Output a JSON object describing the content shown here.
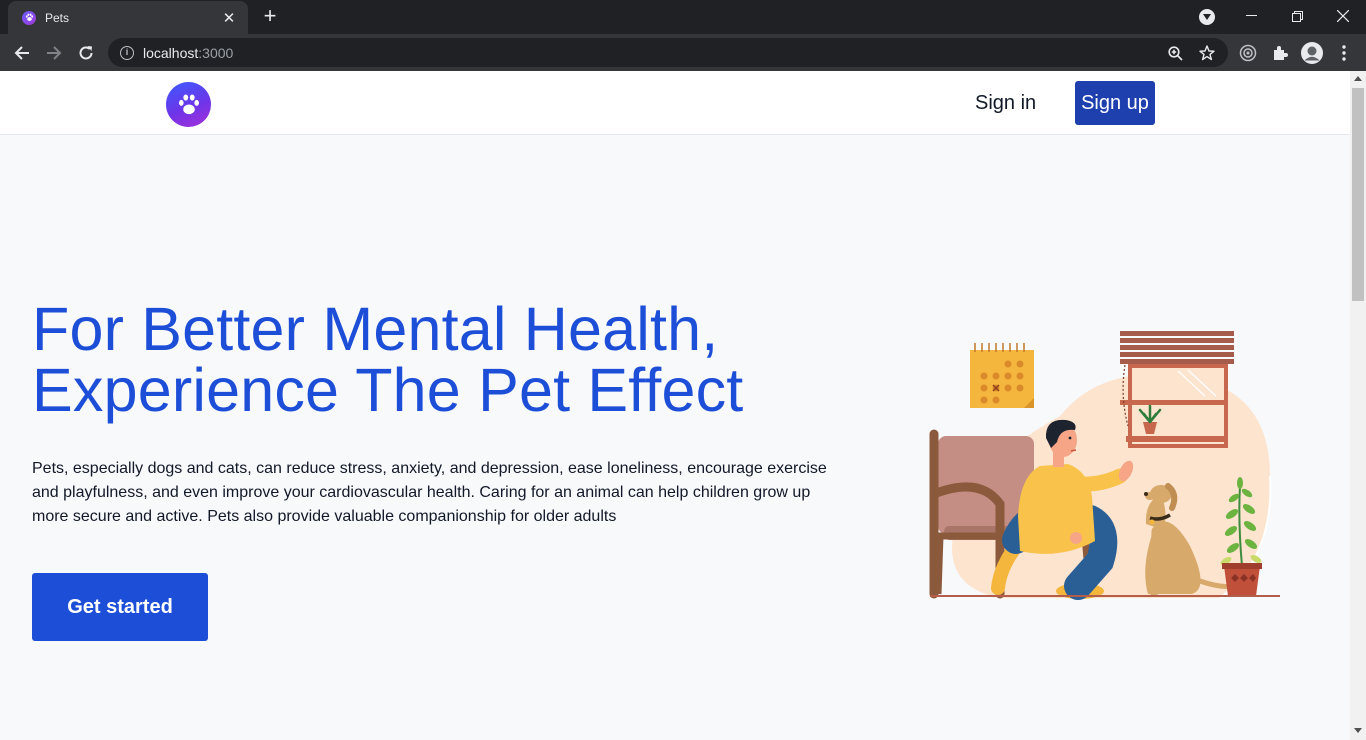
{
  "browser": {
    "tab": {
      "title": "Pets",
      "close_glyph": "✕"
    },
    "new_tab_glyph": "+",
    "url": {
      "host": "localhost",
      "port": ":3000"
    },
    "window_controls": {
      "minimize": "—",
      "maximize": "❐",
      "close": "✕"
    }
  },
  "header": {
    "logo_icon": "paw-icon",
    "signin_label": "Sign in",
    "signup_label": "Sign up"
  },
  "hero": {
    "title": "For Better Mental Health, Experience The Pet Effect",
    "description": "Pets, especially dogs and cats, can reduce stress, anxiety, and depression, ease loneliness, encourage exercise and playfulness, and even improve your cardiovascular health. Caring for an animal can help children grow up more secure and active. Pets also provide valuable companionship for older adults",
    "cta_label": "Get started",
    "illustration": "man-with-dog-illustration"
  },
  "colors": {
    "brand_blue": "#1d4ed8",
    "signup_blue": "#1e40af",
    "page_background": "#f8f9fb",
    "chrome_dark": "#202124",
    "chrome_toolbar": "#35363a"
  }
}
